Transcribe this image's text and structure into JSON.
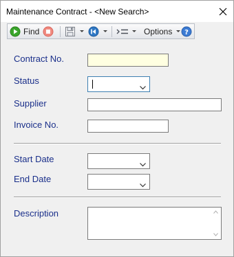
{
  "window": {
    "title": "Maintenance Contract - <New Search>"
  },
  "toolbar": {
    "find_label": "Find",
    "options_label": "Options",
    "icons": {
      "find": "play-icon",
      "stop": "stop-icon",
      "save": "save-icon",
      "navigate": "back-icon",
      "filter": "sort-icon",
      "help": "help-icon"
    }
  },
  "form": {
    "contract_no": {
      "label": "Contract No.",
      "value": ""
    },
    "status": {
      "label": "Status",
      "value": ""
    },
    "supplier": {
      "label": "Supplier",
      "value": ""
    },
    "invoice_no": {
      "label": "Invoice No.",
      "value": ""
    },
    "start_date": {
      "label": "Start Date",
      "value": ""
    },
    "end_date": {
      "label": "End Date",
      "value": ""
    },
    "description": {
      "label": "Description",
      "value": ""
    }
  },
  "colors": {
    "label": "#1a2f8a",
    "required_field_bg": "#ffffe1",
    "focus_border": "#3c7fb1",
    "find_icon": "#3aa52b",
    "stop_icon": "#e0584c",
    "help_icon": "#3b7bd4"
  }
}
